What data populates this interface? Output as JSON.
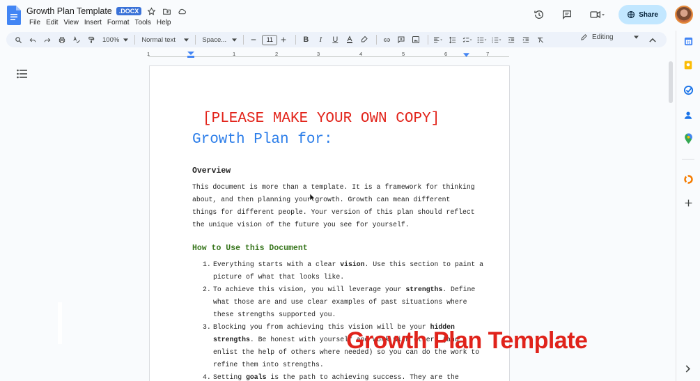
{
  "app": {
    "doc_title": "Growth Plan Template",
    "badge": ".DOCX",
    "menus": [
      "File",
      "Edit",
      "View",
      "Insert",
      "Format",
      "Tools",
      "Help"
    ],
    "share_label": "Share"
  },
  "toolbar": {
    "zoom": "100%",
    "style": "Normal text",
    "font": "Space...",
    "font_size": "11",
    "mode": "Editing"
  },
  "ruler": {
    "numbers": [
      "1",
      "1",
      "2",
      "3",
      "4",
      "5",
      "6",
      "7"
    ]
  },
  "document": {
    "copy_banner": "[PLEASE MAKE YOUR OWN COPY]",
    "heading": "Growth Plan for:",
    "overview_heading": "Overview",
    "overview_text": "This document is more than a template. It is a framework for thinking about, and then planning your growth. Growth can mean different things for different people. Your version of this plan should reflect the unique vision of the future you see for yourself.",
    "howto_heading": "How to Use this Document",
    "howto_items": [
      {
        "num": "1.",
        "parts": [
          {
            "text": "Everything starts with a clear "
          },
          {
            "text": "vision",
            "b": true
          },
          {
            "text": ". Use this section to paint a picture of what that looks like."
          }
        ]
      },
      {
        "num": "2.",
        "parts": [
          {
            "text": "To achieve this vision, you will leverage your "
          },
          {
            "text": "strengths",
            "b": true
          },
          {
            "text": ". Define what those are and use clear examples of past situations where these strengths supported you."
          }
        ]
      },
      {
        "num": "3.",
        "parts": [
          {
            "text": "Blocking you from achieving this vision will be your "
          },
          {
            "text": "hidden strengths",
            "b": true
          },
          {
            "text": ". Be honest with yourself and work with others (and enlist the help of others where needed) so you can do the work to refine them into strengths."
          }
        ]
      },
      {
        "num": "4.",
        "parts": [
          {
            "text": "Setting "
          },
          {
            "text": "goals",
            "b": true
          },
          {
            "text": " is the path to achieving success. They are the"
          }
        ]
      }
    ]
  },
  "overlay": {
    "title": "Growth Plan Template"
  },
  "colors": {
    "banner_red": "#e2231a",
    "heading_blue": "#2b7de9",
    "section_green": "#38761d",
    "share_bg": "#c2e7ff"
  }
}
